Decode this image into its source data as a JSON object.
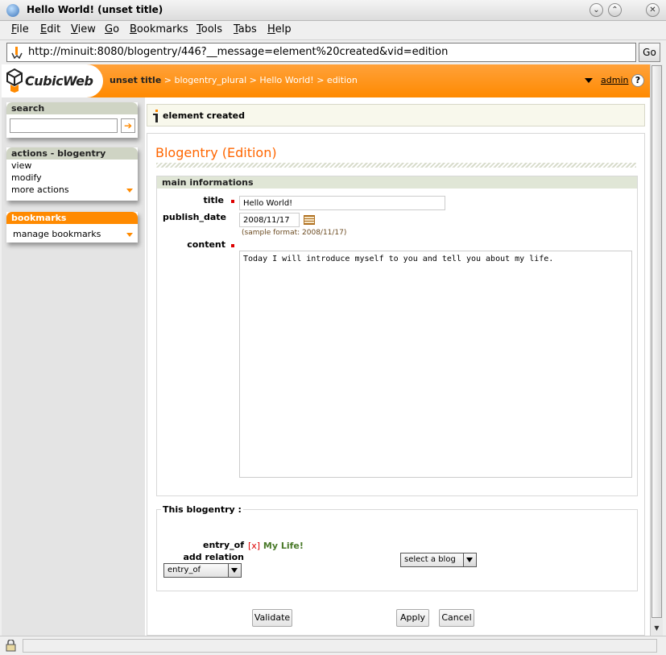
{
  "window": {
    "title": "Hello World! (unset title)"
  },
  "menubar": {
    "items": [
      "File",
      "Edit",
      "View",
      "Go",
      "Bookmarks",
      "Tools",
      "Tabs",
      "Help"
    ]
  },
  "location": {
    "url": "http://minuit:8080/blogentry/446?__message=element%20created&vid=edition",
    "go_label": "Go"
  },
  "header": {
    "logo_text": "CubicWeb",
    "breadcrumb": [
      "unset title",
      "blogentry_plural",
      "Hello World!",
      "edition"
    ],
    "breadcrumb_sep": ">",
    "user": "admin",
    "help_label": "?"
  },
  "sidebar": {
    "search": {
      "title": "search",
      "value": "",
      "go_icon": "arrow-right-icon"
    },
    "actions": {
      "title": "actions - blogentry",
      "items": [
        "view",
        "modify",
        "more actions"
      ]
    },
    "bookmarks": {
      "title": "bookmarks",
      "items": [
        "manage bookmarks"
      ]
    }
  },
  "message": "element created",
  "page": {
    "title": "Blogentry (Edition)",
    "main_section": "main informations",
    "fields": {
      "title": {
        "label": "title",
        "value": "Hello World!"
      },
      "publish_date": {
        "label": "publish_date",
        "value": "2008/11/17",
        "hint": "(sample format: 2008/11/17)"
      },
      "content": {
        "label": "content",
        "value": "Today I will introduce myself to you and tell you about my life."
      }
    },
    "relations": {
      "legend": "This blogentry :",
      "entry_of_label": "entry_of",
      "remove_marker": "[x]",
      "entry_of_value": "My Life!",
      "add_relation_label": "add relation",
      "relation_select": "entry_of",
      "target_select": "select a blog"
    },
    "buttons": {
      "validate": "Validate",
      "apply": "Apply",
      "cancel": "Cancel"
    }
  },
  "colors": {
    "accent": "#ff8a00",
    "title": "#ff6600",
    "link_green": "#4a7a2a",
    "required": "#dd0000"
  }
}
